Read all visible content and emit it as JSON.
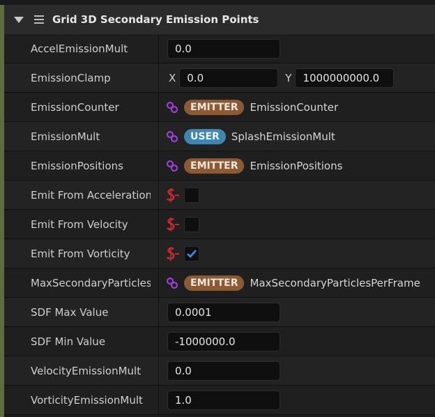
{
  "section": {
    "title": "Grid 3D Secondary Emission Points"
  },
  "rows": [
    {
      "label": "AccelEmissionMult",
      "value": "0.0"
    },
    {
      "label": "EmissionClamp",
      "x_label": "X",
      "x_value": "0.0",
      "y_label": "Y",
      "y_value": "1000000000.0"
    },
    {
      "label": "EmissionCounter",
      "badge": "EMITTER",
      "binding": "EmissionCounter"
    },
    {
      "label": "EmissionMult",
      "badge": "USER",
      "binding": "SplashEmissionMult"
    },
    {
      "label": "EmissionPositions",
      "badge": "EMITTER",
      "binding": "EmissionPositions"
    },
    {
      "label": "Emit From Acceleration",
      "checked": false
    },
    {
      "label": "Emit From Velocity",
      "checked": false
    },
    {
      "label": "Emit From Vorticity",
      "checked": true
    },
    {
      "label": "MaxSecondaryParticlesPerFrame",
      "badge": "EMITTER",
      "binding": "MaxSecondaryParticlesPerFrame"
    },
    {
      "label": "SDF Max Value",
      "value": "0.0001"
    },
    {
      "label": "SDF Min Value",
      "value": "-1000000.0"
    },
    {
      "label": "VelocityEmissionMult",
      "value": "0.0"
    },
    {
      "label": "VorticityEmissionMult",
      "value": "1.0"
    }
  ],
  "colors": {
    "accent": "#5c6e3e",
    "emitter_badge": "#8a5a34",
    "user_badge": "#3f86b0",
    "link_icon": "#9b3fd0",
    "static_icon": "#c8262e",
    "check": "#3b8fe8"
  },
  "icons": {
    "link": "link-icon",
    "static_switch": "static-switch-icon",
    "check": "checkmark-icon"
  }
}
